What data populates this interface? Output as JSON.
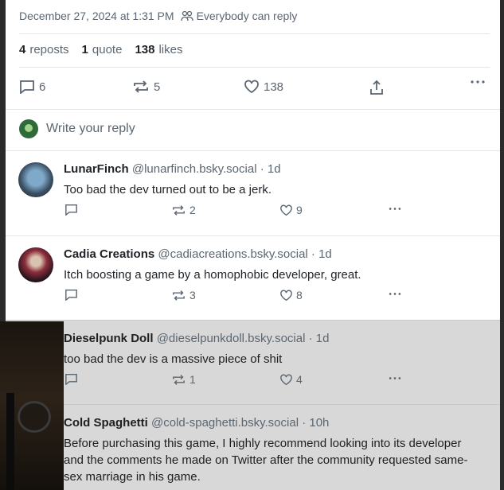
{
  "post_meta": {
    "date": "December 27, 2024 at 1:31 PM",
    "reply_setting": "Everybody can reply",
    "icon": "users-icon"
  },
  "stats": {
    "reposts_count": "4",
    "reposts_label": "reposts",
    "quotes_count": "1",
    "quotes_label": "quote",
    "likes_count": "138",
    "likes_label": "likes"
  },
  "actions": {
    "replies": "6",
    "reposts": "5",
    "likes": "138"
  },
  "reply_box": {
    "placeholder": "Write your reply"
  },
  "replies": [
    {
      "name": "LunarFinch",
      "handle": "@lunarfinch.bsky.social · 1d",
      "text": "Too bad the dev turned out to be a jerk.",
      "reposts": "2",
      "likes": "9"
    },
    {
      "name": "Cadia Creations",
      "handle": "@cadiacreations.bsky.social · 1d",
      "text": "Itch boosting a game by a homophobic developer, great.",
      "reposts": "3",
      "likes": "8"
    },
    {
      "name": "Dieselpunk Doll",
      "handle": "@dieselpunkdoll.bsky.social · 1d",
      "text": "too bad the dev is a massive piece of shit",
      "reposts": "1",
      "likes": "4"
    },
    {
      "name": "Cold Spaghetti",
      "handle": "@cold-spaghetti.bsky.social · 10h",
      "text": "Before purchasing this game, I highly recommend looking into its developer and the comments he made on Twitter after the community requested same-sex marriage in his game."
    }
  ],
  "colors": {
    "text": "#1f2328",
    "muted": "#5b6670",
    "divider": "#e3e6e9",
    "dim_overlay": "#d8d8d8"
  }
}
